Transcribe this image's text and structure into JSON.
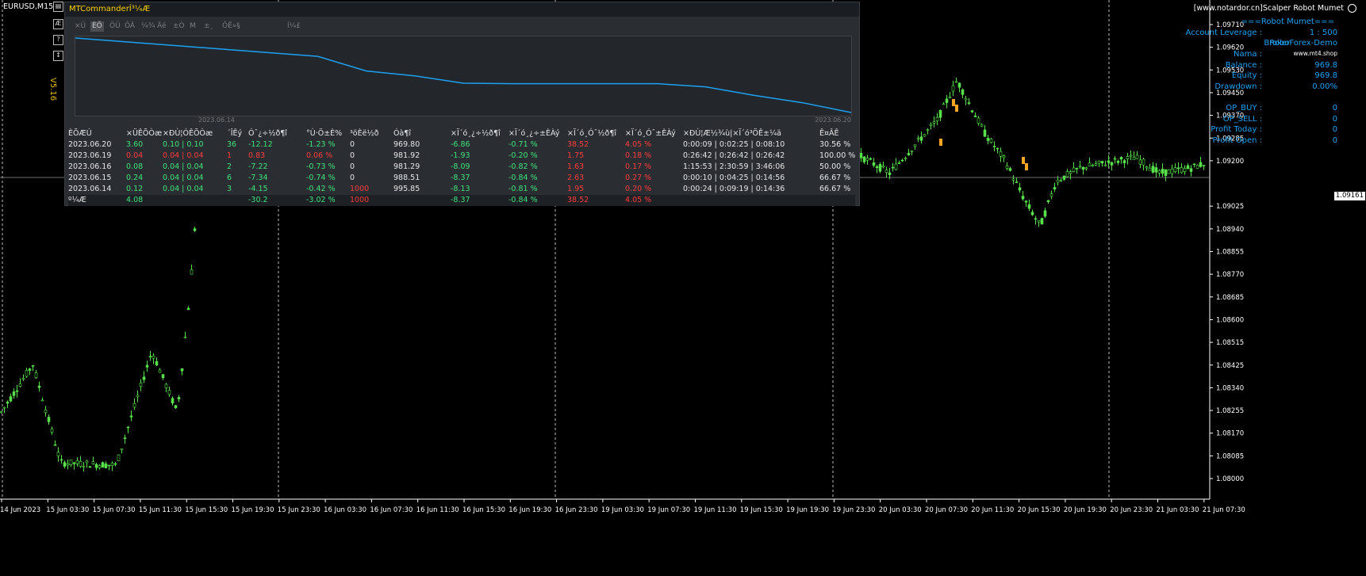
{
  "symbol": "EURUSD,M15",
  "version": "V5.16",
  "watermark": "[www.notardor.cn]Scalper Robot Mumet",
  "price_axis": [
    "1.09710",
    "1.09620",
    "1.09530",
    "1.09450",
    "1.09370",
    "1.09285",
    "1.09200",
    "1.09161",
    "1.09025",
    "1.08940",
    "1.08855",
    "1.08770",
    "1.08685",
    "1.08600",
    "1.08515",
    "1.08425",
    "1.08340",
    "1.08255",
    "1.08170",
    "1.08085",
    "1.08000"
  ],
  "current_price": "1.09161",
  "time_axis": [
    "14 Jun 2023",
    "15 Jun 03:30",
    "15 Jun 07:30",
    "15 Jun 11:30",
    "15 Jun 15:30",
    "15 Jun 19:30",
    "15 Jun 23:30",
    "16 Jun 03:30",
    "16 Jun 07:30",
    "16 Jun 11:30",
    "16 Jun 15:30",
    "16 Jun 19:30",
    "16 Jun 23:30",
    "19 Jun 03:30",
    "19 Jun 07:30",
    "19 Jun 11:30",
    "19 Jun 15:30",
    "19 Jun 19:30",
    "19 Jun 23:30",
    "20 Jun 03:30",
    "20 Jun 07:30",
    "20 Jun 11:30",
    "20 Jun 15:30",
    "20 Jun 19:30",
    "20 Jun 23:30",
    "21 Jun 03:30",
    "21 Jun 07:30"
  ],
  "info_panel": {
    "title": "===Robot Mumet===",
    "rows": [
      {
        "label": "Account Leverage  :",
        "value": "1 : 500"
      },
      {
        "label": "Broker",
        "value": "RoboForex-Demo"
      },
      {
        "label": "Nama  :",
        "value": "www.mt4.shop"
      },
      {
        "label": "Balance  :",
        "value": "969.8"
      },
      {
        "label": "Equity  :",
        "value": "969.8"
      },
      {
        "label": "Drawdown  :",
        "value": "0.00%"
      },
      {
        "label": "OP_BUY  :",
        "value": "0"
      },
      {
        "label": "OP_SELL  :",
        "value": "0"
      },
      {
        "label": "Profit Today  :",
        "value": "0"
      },
      {
        "label": "Profit Open  :",
        "value": "0"
      }
    ]
  },
  "panel": {
    "title": "MTCommanderÍ³¼Æ",
    "tabs": [
      "×Ü",
      "ÈÕ",
      "ÖÜ",
      "ÔÂ",
      "¼¾",
      "Äê",
      "±Ò",
      "M",
      "±¸",
      "ÕË»§",
      "Í¼£"
    ],
    "active_tab": 1,
    "equity_curve": [
      988.5,
      987,
      985.5,
      984,
      982.5,
      981,
      975,
      973,
      970,
      969.8,
      969.8,
      969.8,
      969.8,
      968.5,
      965,
      962,
      958
    ],
    "date_start": "2023.06.14",
    "date_end": "2023.06.20",
    "headers": [
      "ÈÕÆÚ",
      "×ÜÊÕÒæ",
      "×ÐÙ¦ÓÊÕÒæ",
      "´ÎÊý",
      "Ó¯¿÷½ð¶î",
      "°Ù·Ö±È%",
      "³öÈë½ð",
      "Óà¶î",
      "×Ï´ó¸¿÷½ð¶î",
      "×Ï´ó¸¿÷±ÈÀý",
      "×Ï´ó¸Ó¯½ð¶î",
      "×Ï´ó¸Ó¯±ÈÀý",
      "×ÐÙ¦Æ½¾ù|×Ï´ó³ÖÊ±¼ä",
      "Ê¤ÂÊ"
    ],
    "rows": [
      [
        "2023.06.20",
        "3.60",
        "0.10 | 0.10",
        "36",
        "-12.12",
        "-1.23 %",
        "0",
        "969.80",
        "-6.86",
        "-0.71 %",
        "38.52",
        "4.05 %",
        "0:00:09 | 0:02:25 | 0:08:10",
        "30.56 %"
      ],
      [
        "2023.06.19",
        "0.04",
        "0.04 | 0.04",
        "1",
        "0.83",
        "0.06 %",
        "0",
        "981.92",
        "-1.93",
        "-0.20 %",
        "1.75",
        "0.18 %",
        "0:26:42 | 0:26:42 | 0:26:42",
        "100.00 %"
      ],
      [
        "2023.06.16",
        "0.08",
        "0.04 | 0.04",
        "2",
        "-7.22",
        "-0.73 %",
        "0",
        "981.29",
        "-8.09",
        "-0.82 %",
        "1.63",
        "0.17 %",
        "1:15:53 | 2:30:59 | 3:46:06",
        "50.00 %"
      ],
      [
        "2023.06.15",
        "0.24",
        "0.04 | 0.04",
        "6",
        "-7.34",
        "-0.74 %",
        "0",
        "988.51",
        "-8.37",
        "-0.84 %",
        "2.63",
        "0.27 %",
        "0:00:10 | 0:04:25 | 0:14:56",
        "66.67 %"
      ],
      [
        "2023.06.14",
        "0.12",
        "0.04 | 0.04",
        "3",
        "-4.15",
        "-0.42 %",
        "1000",
        "995.85",
        "-8.13",
        "-0.81 %",
        "1.95",
        "0.20 %",
        "0:00:24 | 0:09:19 | 0:14:36",
        "66.67 %"
      ]
    ],
    "row_colors": [
      [
        "white",
        "green",
        "green",
        "green",
        "green",
        "green",
        "white",
        "white",
        "green",
        "green",
        "red",
        "red",
        "white",
        "white"
      ],
      [
        "white",
        "red",
        "red",
        "red",
        "red",
        "red",
        "white",
        "white",
        "green",
        "green",
        "red",
        "red",
        "white",
        "white"
      ],
      [
        "white",
        "green",
        "green",
        "green",
        "green",
        "green",
        "white",
        "white",
        "green",
        "green",
        "red",
        "red",
        "white",
        "white"
      ],
      [
        "white",
        "green",
        "green",
        "green",
        "green",
        "green",
        "white",
        "white",
        "green",
        "green",
        "red",
        "red",
        "white",
        "white"
      ],
      [
        "white",
        "green",
        "green",
        "green",
        "green",
        "green",
        "red",
        "white",
        "green",
        "green",
        "red",
        "red",
        "white",
        "white"
      ]
    ],
    "total": [
      "º¼Æ",
      "4.08",
      "",
      "",
      "-30.2",
      "-3.02 %",
      "1000",
      "",
      "-8.37",
      "-0.84 %",
      "38.52",
      "4.05 %",
      "",
      ""
    ],
    "total_colors": [
      "white",
      "green",
      "white",
      "white",
      "green",
      "green",
      "red",
      "white",
      "green",
      "green",
      "red",
      "red",
      "white",
      "white"
    ]
  },
  "colors": {
    "bull": "#57e04a",
    "curve": "#1da1f2",
    "accent": "#ffd200"
  }
}
